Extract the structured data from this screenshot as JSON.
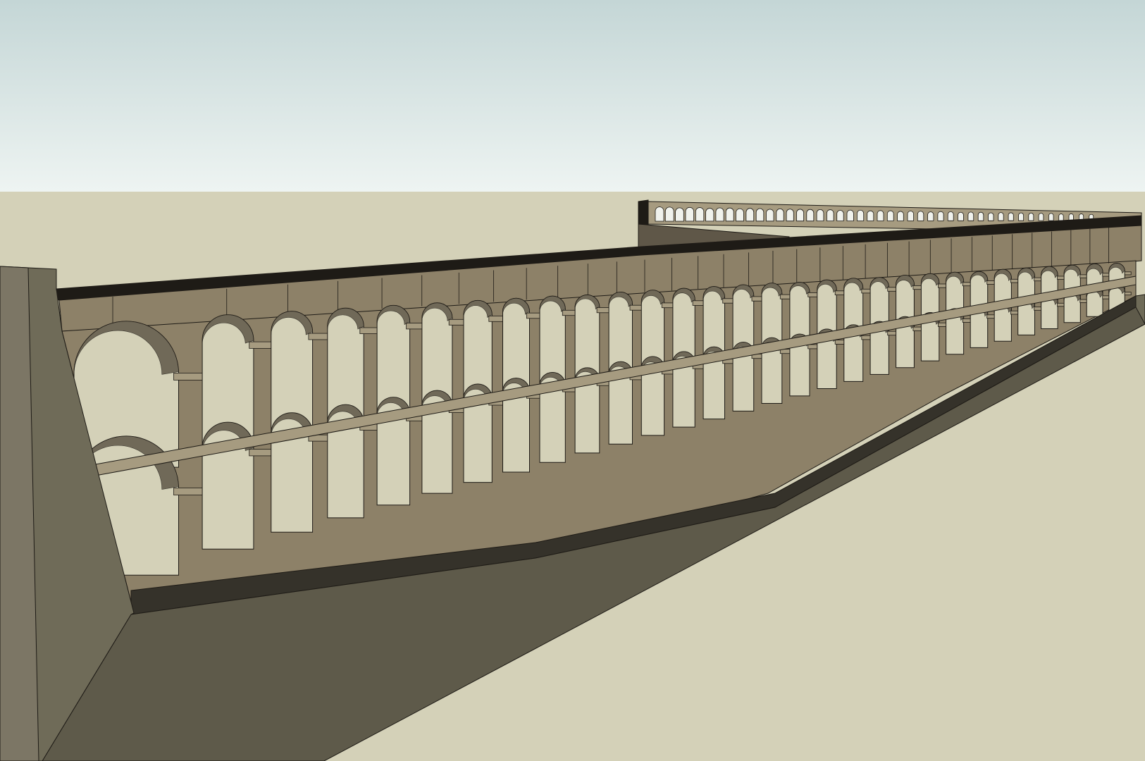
{
  "scene": {
    "colors": {
      "sky_top": "#c4d6d6",
      "sky_bottom": "#eef4f2",
      "ground": "#d4d1b8",
      "slope": "#5e5a4a",
      "slope_light": "#6f6b58",
      "wall_end": "#7c7665",
      "stone": "#8d8168",
      "stone_light": "#a69b80",
      "stone_dark": "#5f5748",
      "edge": "#1e1b16",
      "shadow_gap": "#35322a"
    },
    "tiers": 2,
    "model": "aqueduct-arcade"
  }
}
